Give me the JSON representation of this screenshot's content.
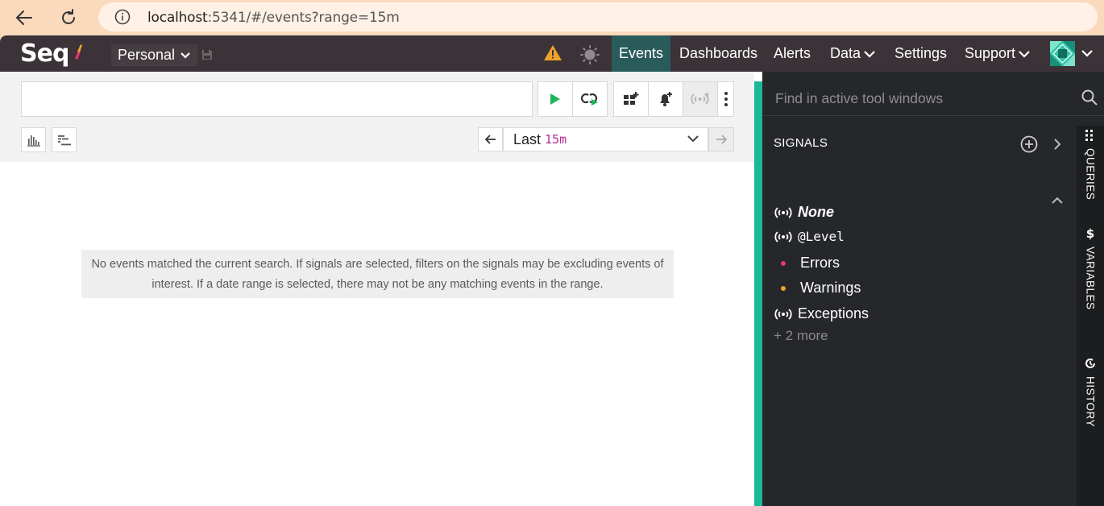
{
  "browser": {
    "url_host": "localhost",
    "url_rest": ":5341/#/events?range=15m"
  },
  "app": {
    "logo": "Seq",
    "workspace": "Personal",
    "nav": {
      "events": "Events",
      "dashboards": "Dashboards",
      "alerts": "Alerts",
      "data": "Data",
      "settings": "Settings",
      "support": "Support"
    }
  },
  "query": {
    "search_value": "",
    "range_label": "Last",
    "range_value": "15m"
  },
  "results": {
    "empty_message": "No events matched the current search. If signals are selected, filters on the signals may be excluding events of interest. If a date range is selected, there may not be any matching events in the range."
  },
  "tool_pane": {
    "find_placeholder": "Find in active tool windows",
    "signals_heading": "SIGNALS",
    "signals": [
      {
        "label": "None"
      },
      {
        "label": "@Level"
      },
      {
        "label": "Errors",
        "color": "#e8366d"
      },
      {
        "label": "Warnings",
        "color": "#f0a32b"
      },
      {
        "label": "Exceptions"
      }
    ],
    "more": "+ 2 more",
    "tabs": {
      "queries": "QUERIES",
      "variables": "VARIABLES",
      "history": "HISTORY"
    }
  },
  "colors": {
    "accent": "#1bb898",
    "topbar": "#3b3338",
    "active_nav": "#2a5b5b"
  }
}
